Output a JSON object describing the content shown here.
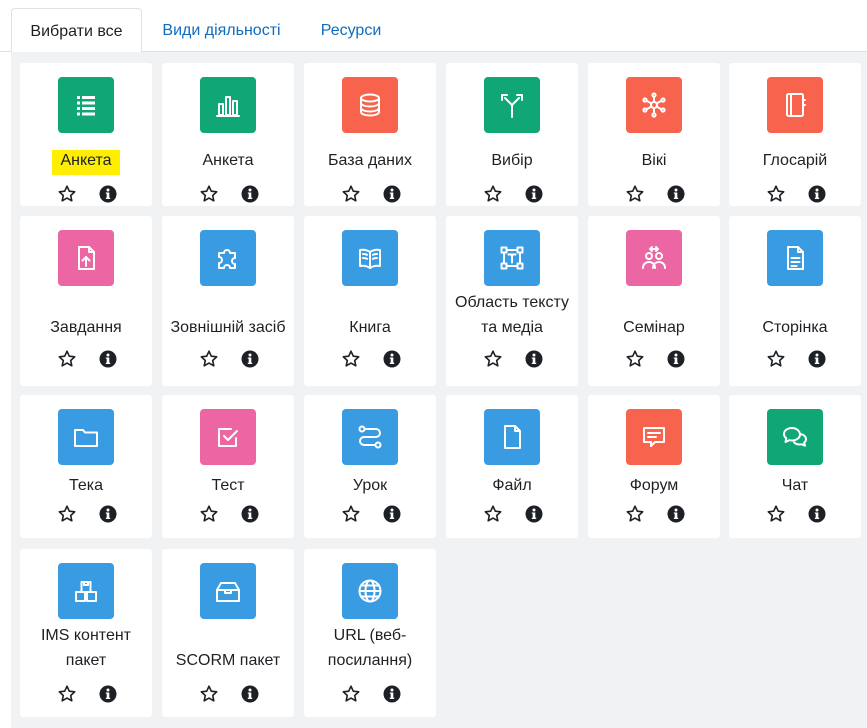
{
  "tabs": [
    {
      "label": "Вибрати все",
      "active": true
    },
    {
      "label": "Види діяльності",
      "active": false
    },
    {
      "label": "Ресурси",
      "active": false
    }
  ],
  "colors": {
    "green": "#11a676",
    "red": "#f7634d",
    "pink": "#eb66a2",
    "blue": "#399be2",
    "highlight": "#ffee00"
  },
  "modules": [
    {
      "label": "Анкета",
      "icon": "feedback-icon",
      "color": "green",
      "highlighted": true
    },
    {
      "label": "Анкета",
      "icon": "survey-chart-icon",
      "color": "green"
    },
    {
      "label": "База даних",
      "icon": "database-icon",
      "color": "red"
    },
    {
      "label": "Вибір",
      "icon": "choice-signpost-icon",
      "color": "green"
    },
    {
      "label": "Вікі",
      "icon": "wiki-network-icon",
      "color": "red"
    },
    {
      "label": "Глосарій",
      "icon": "glossary-book-icon",
      "color": "red"
    },
    {
      "label": "Завдання",
      "icon": "assignment-upload-icon",
      "color": "pink"
    },
    {
      "label": "Зовнішній засіб",
      "icon": "puzzle-piece-icon",
      "color": "blue"
    },
    {
      "label": "Книга",
      "icon": "open-book-icon",
      "color": "blue"
    },
    {
      "label": "Область тексту та медіа",
      "icon": "text-media-icon",
      "color": "blue"
    },
    {
      "label": "Семінар",
      "icon": "workshop-people-icon",
      "color": "pink"
    },
    {
      "label": "Сторінка",
      "icon": "page-document-icon",
      "color": "blue"
    },
    {
      "label": "Тека",
      "icon": "folder-icon",
      "color": "blue"
    },
    {
      "label": "Тест",
      "icon": "quiz-checkbox-icon",
      "color": "pink"
    },
    {
      "label": "Урок",
      "icon": "lesson-path-icon",
      "color": "blue"
    },
    {
      "label": "Файл",
      "icon": "file-icon",
      "color": "blue"
    },
    {
      "label": "Форум",
      "icon": "forum-speech-icon",
      "color": "red"
    },
    {
      "label": "Чат",
      "icon": "chat-bubbles-icon",
      "color": "green"
    },
    {
      "label": "IMS контент пакет",
      "icon": "ims-package-icon",
      "color": "blue"
    },
    {
      "label": "SCORM пакет",
      "icon": "scorm-box-icon",
      "color": "blue"
    },
    {
      "label": "URL (веб-посилання)",
      "icon": "url-globe-icon",
      "color": "blue"
    }
  ],
  "actions": {
    "star_icon": "star-icon",
    "info_icon": "info-icon"
  }
}
